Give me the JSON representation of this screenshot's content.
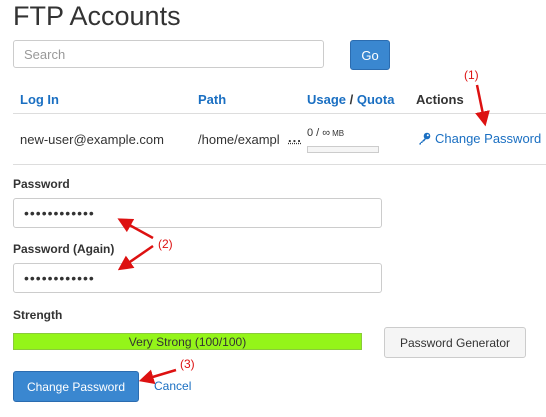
{
  "page": {
    "title": "FTP Accounts"
  },
  "search": {
    "placeholder": "Search",
    "value": "",
    "go_label": "Go"
  },
  "table": {
    "columns": {
      "login": "Log In",
      "path": "Path",
      "usage": "Usage",
      "usage_sep": " / ",
      "quota": "Quota",
      "actions": "Actions"
    },
    "row": {
      "login": "new-user@example.com",
      "path": "/home/exampl",
      "path_more": "...",
      "usage_used": "0 / ∞",
      "usage_unit": "MB",
      "usage_fraction": 0,
      "action": "Change Password",
      "action_icon": "key-icon"
    }
  },
  "form": {
    "password_label": "Password",
    "password_value": "••••••••••••",
    "password_again_label": "Password (Again)",
    "password_again_value": "••••••••••••",
    "strength_label": "Strength",
    "strength_text": "Very Strong (100/100)",
    "strength_fraction": 1.0,
    "strength_color": "#94f519",
    "generator_label": "Password Generator",
    "submit_label": "Change Password",
    "cancel_label": "Cancel"
  },
  "annotations": {
    "step1": "(1)",
    "step2": "(2)",
    "step3": "(3)",
    "color": "#dd1111"
  },
  "colors": {
    "accent": "#3a87d0",
    "link": "#1a6fc2"
  }
}
